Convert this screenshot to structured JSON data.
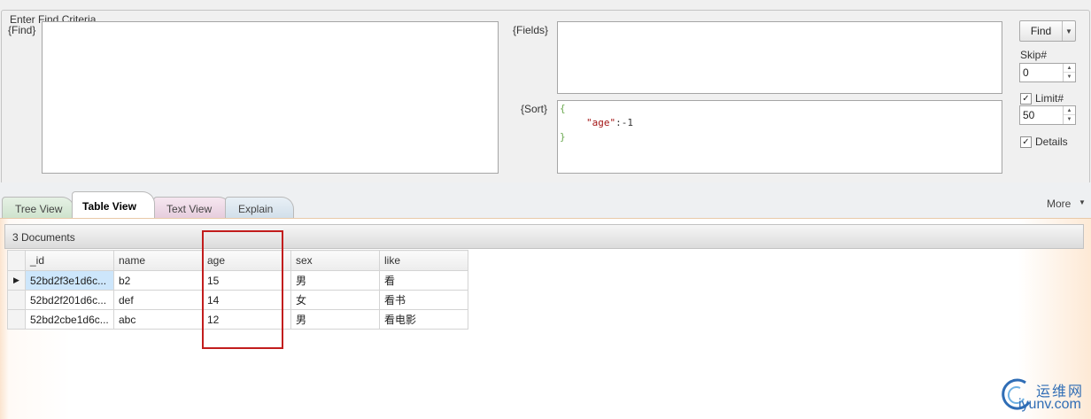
{
  "criteria": {
    "group_title": "Enter Find Criteria",
    "find_label": "{Find}",
    "fields_label": "{Fields}",
    "sort_label": "{Sort}",
    "sort_value": {
      "open": "{",
      "key": "\"age\"",
      "sep": ":",
      "val": "-1",
      "close": "}"
    }
  },
  "controls": {
    "find_button": "Find",
    "skip_label": "Skip#",
    "skip_value": "0",
    "limit_label": "Limit#",
    "limit_checked": true,
    "limit_value": "50",
    "details_label": "Details",
    "details_checked": true
  },
  "tabs": [
    {
      "label": "Tree View",
      "active": false,
      "color": "#d7e8d6"
    },
    {
      "label": "Table View",
      "active": true,
      "color": "#ffffff"
    },
    {
      "label": "Text View",
      "active": false,
      "color": "#ecd6e4"
    },
    {
      "label": "Explain",
      "active": false,
      "color": "#d7e3ee"
    }
  ],
  "more_label": "More",
  "results": {
    "summary": "3 Documents",
    "columns": [
      "_id",
      "name",
      "age",
      "sex",
      "like"
    ],
    "rows": [
      [
        "52bd2f3e1d6c...",
        "b2",
        "15",
        "男",
        "看"
      ],
      [
        "52bd2f201d6c...",
        "def",
        "14",
        "女",
        "看书"
      ],
      [
        "52bd2cbe1d6c...",
        "abc",
        "12",
        "男",
        "看电影"
      ]
    ]
  },
  "watermark": {
    "line1": "运维网",
    "line2": "iyunv.com"
  }
}
